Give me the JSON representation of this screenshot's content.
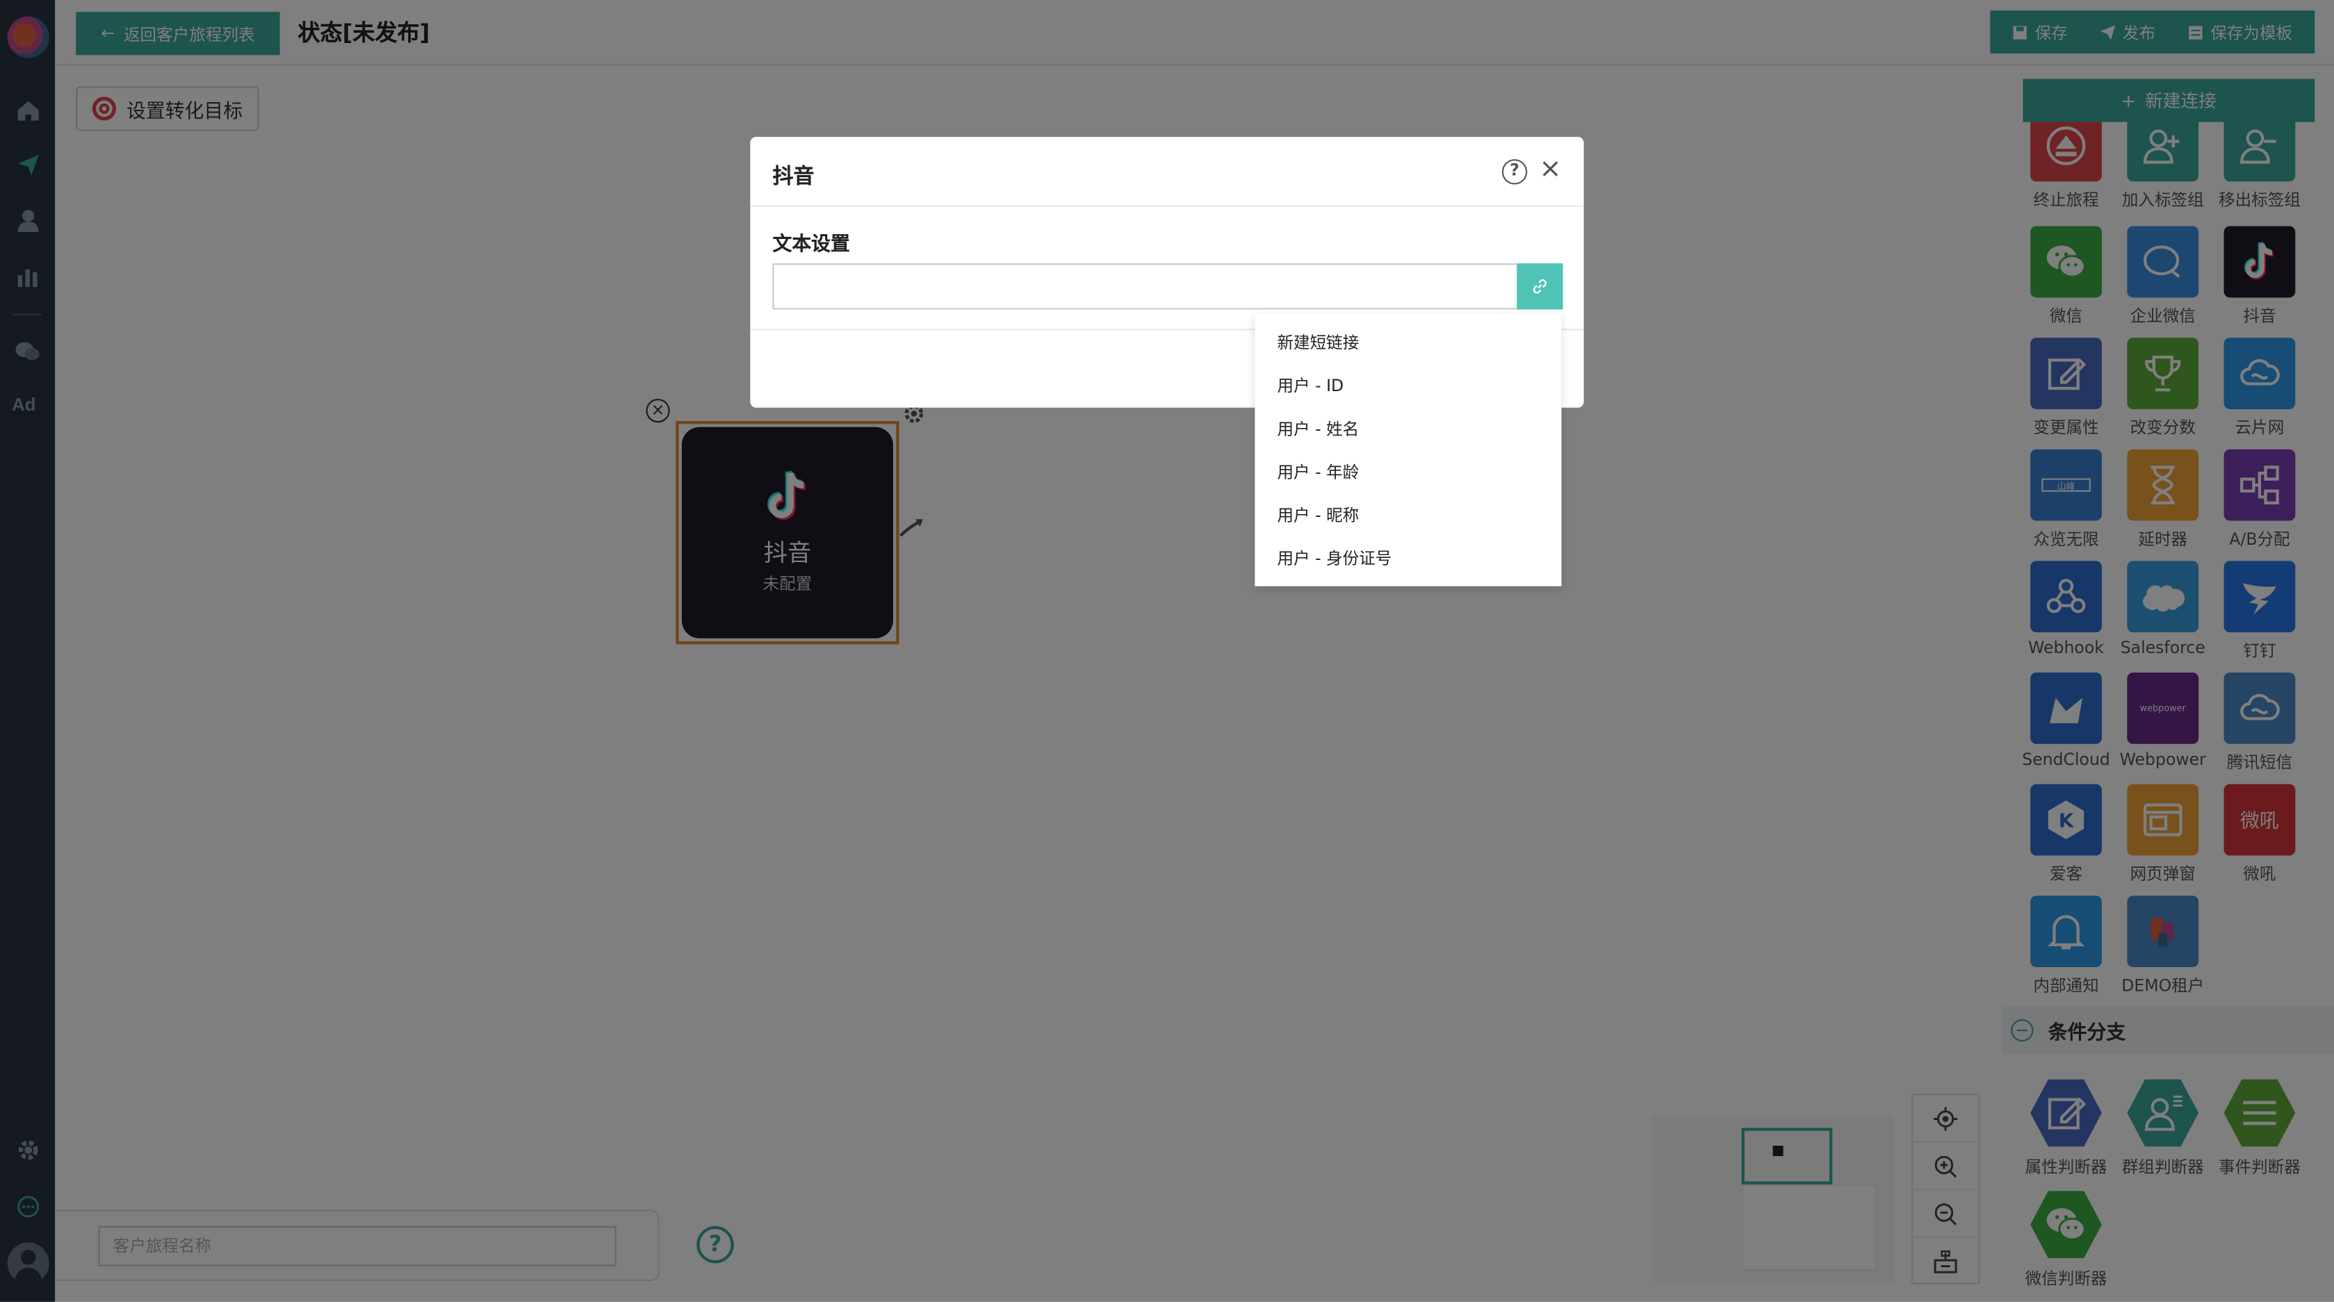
{
  "topbar": {
    "back_label": "返回客户旅程列表",
    "title": "状态[未发布]",
    "save_label": "保存",
    "publish_label": "发布",
    "save_template_label": "保存为模板"
  },
  "sidebar": {
    "items": [
      "home-icon",
      "send-icon",
      "user-icon",
      "bar-chart-icon",
      "wechat-icon",
      "ad-icon",
      "settings-icon",
      "chat-icon"
    ],
    "ad_label": "Ad"
  },
  "canvas": {
    "goal_label": "设置转化目标",
    "node": {
      "title": "抖音",
      "subtitle": "未配置"
    },
    "journey_name_placeholder": "客户旅程名称",
    "help_mark": "?"
  },
  "right_panel": {
    "new_connection_label": "新建连接",
    "tiles": [
      {
        "label": "终止旅程",
        "color": "#e0474c",
        "icon": "stop-icon"
      },
      {
        "label": "加入标签组",
        "color": "#3aa89c",
        "icon": "add-user-icon"
      },
      {
        "label": "移出标签组",
        "color": "#3aa89c",
        "icon": "remove-user-icon"
      },
      {
        "label": "微信",
        "color": "#3dae43",
        "icon": "wechat-icon"
      },
      {
        "label": "企业微信",
        "color": "#3a8ee0",
        "icon": "work-wechat-icon"
      },
      {
        "label": "抖音",
        "color": "#221a2a",
        "icon": "tiktok-icon"
      },
      {
        "label": "变更属性",
        "color": "#4a6bc4",
        "icon": "edit-icon"
      },
      {
        "label": "改变分数",
        "color": "#5fae3a",
        "icon": "trophy-icon"
      },
      {
        "label": "云片网",
        "color": "#2e9ae8",
        "icon": "cloud-icon"
      },
      {
        "label": "众览无限",
        "color": "#3b80d6",
        "icon": "zhonglan-icon"
      },
      {
        "label": "延时器",
        "color": "#f0a23a",
        "icon": "hourglass-icon"
      },
      {
        "label": "A/B分配",
        "color": "#7b3fb6",
        "icon": "ab-split-icon"
      },
      {
        "label": "Webhook",
        "color": "#2d6fd0",
        "icon": "webhook-icon"
      },
      {
        "label": "Salesforce",
        "color": "#3aa0e0",
        "icon": "salesforce-icon"
      },
      {
        "label": "钉钉",
        "color": "#2878e8",
        "icon": "dingtalk-icon"
      },
      {
        "label": "SendCloud",
        "color": "#2d6fd0",
        "icon": "sendcloud-icon"
      },
      {
        "label": "Webpower",
        "color": "#6b2a8a",
        "icon": "webpower-icon"
      },
      {
        "label": "腾讯短信",
        "color": "#4d8ac8",
        "icon": "tencent-sms-icon"
      },
      {
        "label": "爱客",
        "color": "#2d6fd0",
        "icon": "aike-icon"
      },
      {
        "label": "网页弹窗",
        "color": "#f0a23a",
        "icon": "popup-icon"
      },
      {
        "label": "微吼",
        "color": "#d8353a",
        "icon": "weihou-icon"
      },
      {
        "label": "内部通知",
        "color": "#2e9ae8",
        "icon": "bell-icon"
      },
      {
        "label": "DEMO租户",
        "color": "#4a8ac8",
        "icon": "demo-tenant-icon"
      }
    ],
    "webpower_text": "webpower",
    "zhonglan_text": "山峰",
    "weihou_text": "微吼",
    "section_label": "条件分支",
    "branch_tiles": [
      {
        "label": "属性判断器",
        "color": "#4a6bc4",
        "icon": "edit-icon"
      },
      {
        "label": "群组判断器",
        "color": "#3aa89c",
        "icon": "group-judge-icon"
      },
      {
        "label": "事件判断器",
        "color": "#5fae3a",
        "icon": "list-icon"
      },
      {
        "label": "微信判断器",
        "color": "#3dae43",
        "icon": "wechat-icon"
      }
    ]
  },
  "modal": {
    "title": "抖音",
    "help": "?",
    "close": "×",
    "section_label": "文本设置",
    "text_value": "",
    "dropdown_items": [
      "新建短链接",
      "用户 - ID",
      "用户 - 姓名",
      "用户 - 年龄",
      "用户 - 昵称",
      "用户 - 身份证号"
    ]
  },
  "colors": {
    "accent": "#3aa89c",
    "sidebar": "#2a3542",
    "node_border": "#e28a2a"
  }
}
